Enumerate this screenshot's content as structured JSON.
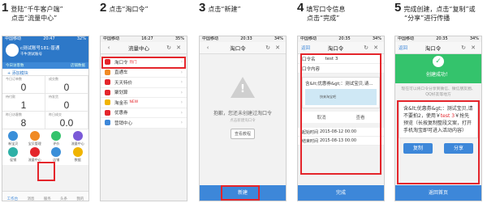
{
  "steps": [
    {
      "num": "1",
      "line1": "登陆“千牛客户端”",
      "line2": "点击“流量中心”"
    },
    {
      "num": "2",
      "line1": "点击“淘口令”",
      "line2": ""
    },
    {
      "num": "3",
      "line1": "点击“新建”",
      "line2": ""
    },
    {
      "num": "4",
      "line1": "填写口令信息",
      "line2": "点击“完成”"
    },
    {
      "num": "5",
      "line1": "完成创建，点击“复制”或",
      "line2": "“分享”进行传播"
    }
  ],
  "phone1": {
    "status_left": "中国移动",
    "status_time": "20:47",
    "status_right": "32%",
    "shop_name": "c测试账号181:普通",
    "shop_id": "千牛测试账号",
    "bar_left": "今日访客数",
    "bar_right": "店铺数据",
    "add_label": "+ 添加模块",
    "stats": [
      {
        "label": "今日订单数",
        "value": "0"
      },
      {
        "label": "成交数",
        "value": "0"
      },
      {
        "label": "待付款",
        "value": "1"
      },
      {
        "label": "待发货",
        "value": "0"
      },
      {
        "label": "昨日访客数",
        "value": "8"
      },
      {
        "label": "昨日成交",
        "value": "0.0"
      }
    ],
    "icons": [
      "新宝贝",
      "宝贝管理",
      "评价",
      "流量中心",
      "促销",
      "流量中心",
      "店铺",
      "数据"
    ],
    "tabs": [
      "工作台",
      "消息",
      "服务",
      "头条",
      "我的"
    ]
  },
  "phone2": {
    "status_left": "中国移动",
    "status_time": "16:27",
    "status_right": "35%",
    "title": "流量中心",
    "menu": [
      {
        "label": "淘口令",
        "tag": "热门",
        "color": "#e4252b"
      },
      {
        "label": "直通车",
        "tag": "",
        "color": "#f08a24"
      },
      {
        "label": "天天特价",
        "tag": "",
        "color": "#e4252b"
      },
      {
        "label": "聚划算",
        "tag": "",
        "color": "#e4252b"
      },
      {
        "label": "淘金币",
        "tag": "NEW",
        "color": "#f0b400"
      },
      {
        "label": "优惠券",
        "tag": "",
        "color": "#e4252b"
      },
      {
        "label": "营销中心",
        "tag": "",
        "color": "#3d87d9"
      }
    ]
  },
  "phone3": {
    "status_left": "中国移动",
    "status_time": "20:33",
    "status_right": "34%",
    "title": "淘口令",
    "empty_title": "抱歉，您还未创建过淘口令",
    "empty_sub": "点击新建淘口令",
    "empty_button": "查看教程",
    "bottom_button": "新建"
  },
  "phone4": {
    "status_left": "中国移动",
    "status_time": "20:35",
    "status_right": "34%",
    "back": "返回",
    "title": "淘口令",
    "name_label": "口令名",
    "name_value": "test 3",
    "content_label": "口令内容",
    "card_title": "含&lt;优惠券&gt;：测试宝贝,请...",
    "card_img_text": "快来淘宝吧",
    "cancel": "取消",
    "view": "查看",
    "start_label": "起始时间",
    "start_value": "2015-08-12 00:00",
    "end_label": "结束时间",
    "end_value": "2015-08-13 00:00",
    "bottom_button": "完成"
  },
  "phone5": {
    "status_left": "中国移动",
    "status_time": "20:35",
    "status_right": "34%",
    "back": "返回",
    "title": "淘口令",
    "success": "创建成功！",
    "tip": "现在可以将口令分享到微信、微信朋友圈、QQ好友等地方",
    "share_pre": "含&lt;优惠券&gt;：测试宝贝,请",
    "share_mid": "不要拍2，使用￥",
    "share_code": "test 3",
    "share_post": "￥抢先预览（长按复制整段文案，打开手机淘宝即可进入活动内容）",
    "copy": "复制",
    "share": "分享",
    "bottom_button": "返回首页"
  },
  "colors": {
    "highlight": "#e4252b",
    "blue": "#3d87d9",
    "green": "#34c36c"
  }
}
